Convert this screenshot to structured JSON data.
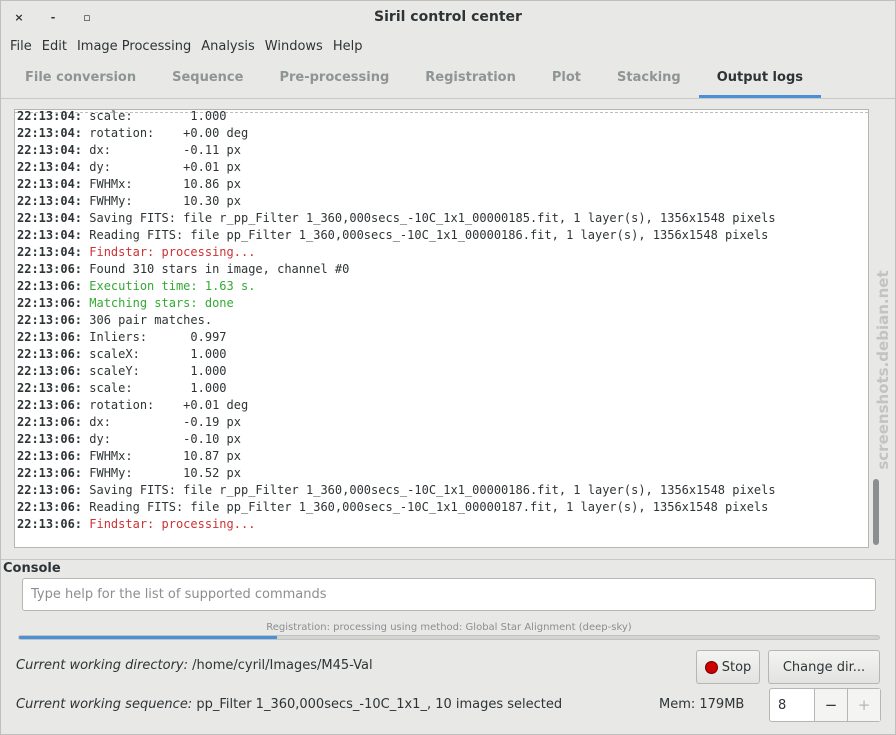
{
  "window": {
    "title": "Siril control center",
    "controls": {
      "close": "×",
      "minimize": "-",
      "maximize": "▫"
    }
  },
  "menu": [
    "File",
    "Edit",
    "Image Processing",
    "Analysis",
    "Windows",
    "Help"
  ],
  "tabs": [
    {
      "label": "File conversion",
      "active": false
    },
    {
      "label": "Sequence",
      "active": false
    },
    {
      "label": "Pre-processing",
      "active": false
    },
    {
      "label": "Registration",
      "active": false
    },
    {
      "label": "Plot",
      "active": false
    },
    {
      "label": "Stacking",
      "active": false
    },
    {
      "label": "Output logs",
      "active": true
    }
  ],
  "log": [
    {
      "time": "22:13:04:",
      "text": " scale:        1.000",
      "color": "normal"
    },
    {
      "time": "22:13:04:",
      "text": " rotation:    +0.00 deg",
      "color": "normal"
    },
    {
      "time": "22:13:04:",
      "text": " dx:          -0.11 px",
      "color": "normal"
    },
    {
      "time": "22:13:04:",
      "text": " dy:          +0.01 px",
      "color": "normal"
    },
    {
      "time": "22:13:04:",
      "text": " FWHMx:       10.86 px",
      "color": "normal"
    },
    {
      "time": "22:13:04:",
      "text": " FWHMy:       10.30 px",
      "color": "normal"
    },
    {
      "time": "22:13:04:",
      "text": " Saving FITS: file r_pp_Filter 1_360,000secs_-10C_1x1_00000185.fit, 1 layer(s), 1356x1548 pixels",
      "color": "normal"
    },
    {
      "time": "22:13:04:",
      "text": " Reading FITS: file pp_Filter 1_360,000secs_-10C_1x1_00000186.fit, 1 layer(s), 1356x1548 pixels",
      "color": "normal"
    },
    {
      "time": "22:13:04:",
      "text": " Findstar: processing...",
      "color": "red"
    },
    {
      "time": "22:13:06:",
      "text": " Found 310 stars in image, channel #0",
      "color": "normal"
    },
    {
      "time": "22:13:06:",
      "text": " Execution time: 1.63 s.",
      "color": "green"
    },
    {
      "time": "22:13:06:",
      "text": " Matching stars: done",
      "color": "green"
    },
    {
      "time": "22:13:06:",
      "text": " 306 pair matches.",
      "color": "normal"
    },
    {
      "time": "22:13:06:",
      "text": " Inliers:      0.997",
      "color": "normal"
    },
    {
      "time": "22:13:06:",
      "text": " scaleX:       1.000",
      "color": "normal"
    },
    {
      "time": "22:13:06:",
      "text": " scaleY:       1.000",
      "color": "normal"
    },
    {
      "time": "22:13:06:",
      "text": " scale:        1.000",
      "color": "normal"
    },
    {
      "time": "22:13:06:",
      "text": " rotation:    +0.01 deg",
      "color": "normal"
    },
    {
      "time": "22:13:06:",
      "text": " dx:          -0.19 px",
      "color": "normal"
    },
    {
      "time": "22:13:06:",
      "text": " dy:          -0.10 px",
      "color": "normal"
    },
    {
      "time": "22:13:06:",
      "text": " FWHMx:       10.87 px",
      "color": "normal"
    },
    {
      "time": "22:13:06:",
      "text": " FWHMy:       10.52 px",
      "color": "normal"
    },
    {
      "time": "22:13:06:",
      "text": " Saving FITS: file r_pp_Filter 1_360,000secs_-10C_1x1_00000186.fit, 1 layer(s), 1356x1548 pixels",
      "color": "normal"
    },
    {
      "time": "22:13:06:",
      "text": " Reading FITS: file pp_Filter 1_360,000secs_-10C_1x1_00000187.fit, 1 layer(s), 1356x1548 pixels",
      "color": "normal"
    },
    {
      "time": "22:13:06:",
      "text": " Findstar: processing...",
      "color": "red"
    }
  ],
  "watermark": "screenshots.debian.net",
  "console": {
    "label": "Console",
    "placeholder": "Type help for the list of supported commands"
  },
  "progress": {
    "text": "Registration: processing using method: Global Star Alignment (deep-sky)",
    "fraction": 0.3
  },
  "cwd": {
    "label": "Current working directory:",
    "value": "/home/cyril/Images/M45-Val"
  },
  "cws": {
    "label": "Current working sequence:",
    "value": "pp_Filter 1_360,000secs_-10C_1x1_, 10 images selected"
  },
  "buttons": {
    "stop": "Stop",
    "change_dir": "Change dir..."
  },
  "mem": "Mem: 179MB",
  "threads": {
    "value": "8",
    "minus": "−",
    "plus": "+"
  },
  "colors": {
    "accent": "#4a90d9",
    "log_red": "#cc3333",
    "log_green": "#33aa33",
    "stop_red": "#cc0000"
  }
}
